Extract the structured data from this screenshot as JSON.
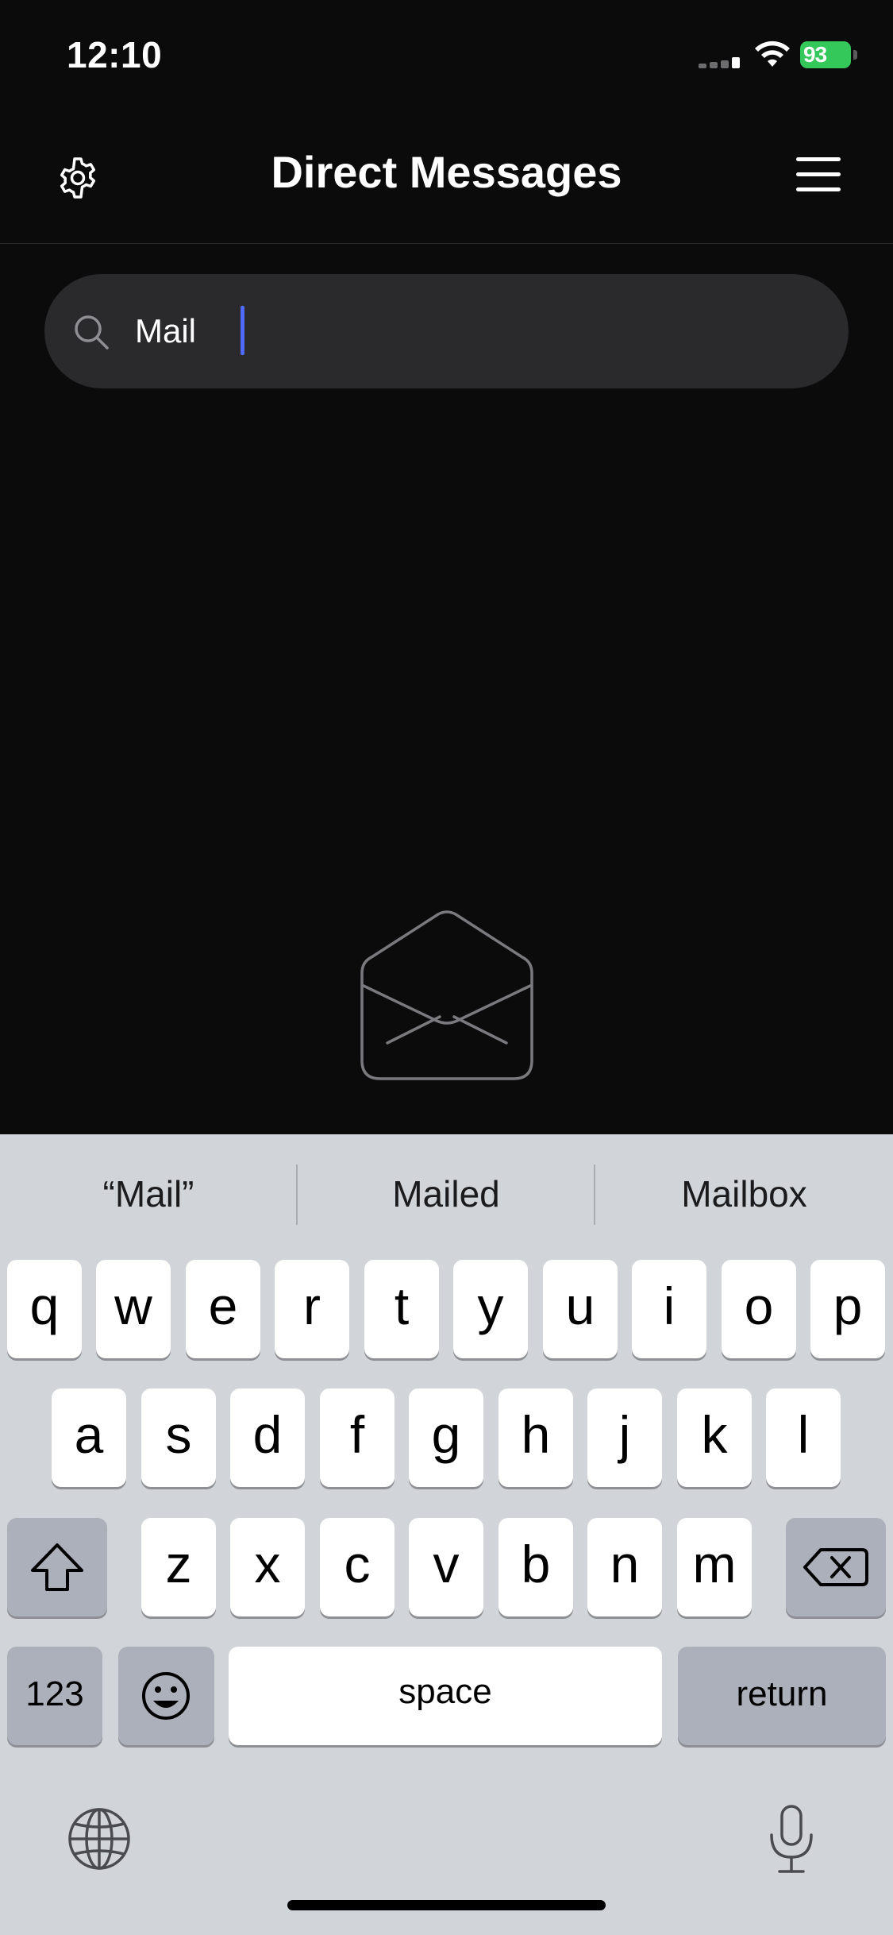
{
  "status_bar": {
    "time": "12:10",
    "battery": "93"
  },
  "header": {
    "title": "Direct Messages"
  },
  "search": {
    "value": "Mail",
    "placeholder": ""
  },
  "keyboard": {
    "suggestions": [
      "“Mail”",
      "Mailed",
      "Mailbox"
    ],
    "row1": [
      "q",
      "w",
      "e",
      "r",
      "t",
      "y",
      "u",
      "i",
      "o",
      "p"
    ],
    "row2": [
      "a",
      "s",
      "d",
      "f",
      "g",
      "h",
      "j",
      "k",
      "l"
    ],
    "row3": [
      "z",
      "x",
      "c",
      "v",
      "b",
      "n",
      "m"
    ],
    "numbers_label": "123",
    "space_label": "space",
    "return_label": "return"
  },
  "colors": {
    "background": "#0b0b0c",
    "search_bg": "#2a2a2c",
    "caret": "#4f6bff",
    "battery": "#34c759",
    "keyboard_bg": "#d1d4d9"
  }
}
